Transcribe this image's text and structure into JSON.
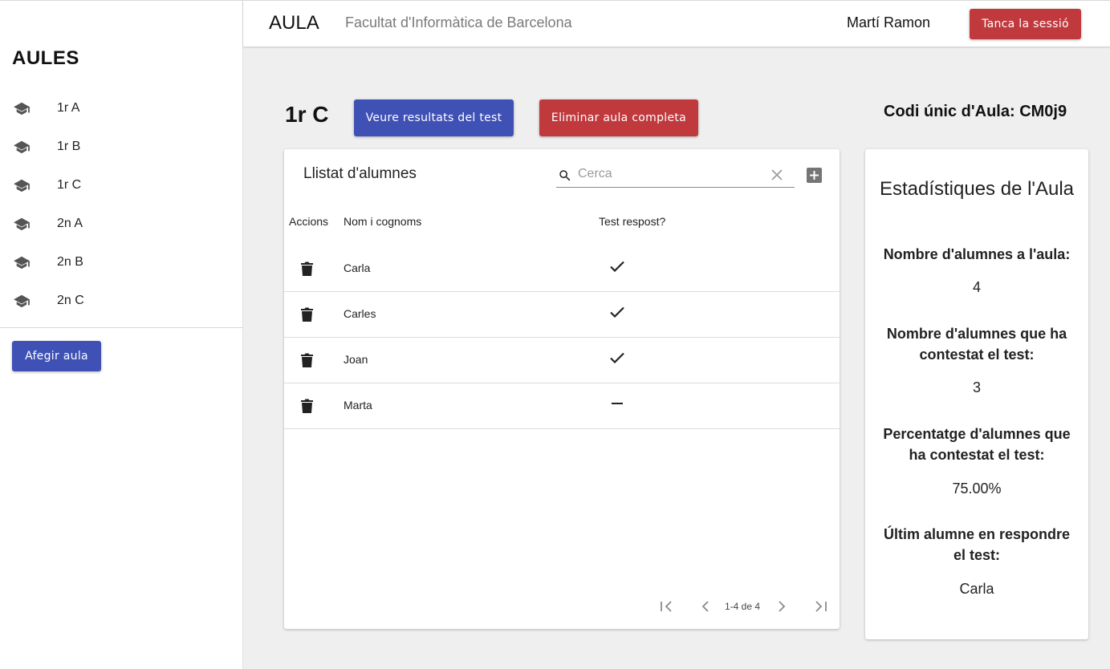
{
  "sidebar": {
    "title": "AULES",
    "items": [
      {
        "label": "1r A"
      },
      {
        "label": "1r B"
      },
      {
        "label": "1r C"
      },
      {
        "label": "2n A"
      },
      {
        "label": "2n B"
      },
      {
        "label": "2n C"
      }
    ],
    "add_label": "Afegir aula"
  },
  "header": {
    "app_title": "AULA",
    "subtitle": "Facultat d'Informàtica de Barcelona",
    "user_name": "Martí Ramon",
    "logout_label": "Tanca la sessió"
  },
  "aula": {
    "name": "1r C",
    "results_label": "Veure resultats del test",
    "delete_label": "Eliminar aula completa",
    "code_label": "Codi únic d'Aula: CM0j9"
  },
  "students": {
    "title": "Llistat d'alumnes",
    "search_placeholder": "Cerca",
    "columns": {
      "actions": "Accions",
      "name": "Nom i cognoms",
      "answered": "Test respost?"
    },
    "rows": [
      {
        "name": "Carla",
        "answered": true
      },
      {
        "name": "Carles",
        "answered": true
      },
      {
        "name": "Joan",
        "answered": true
      },
      {
        "name": "Marta",
        "answered": false
      }
    ],
    "pagination": "1-4 de 4"
  },
  "stats": {
    "title": "Estadístiques de l'Aula",
    "total_label": "Nombre d'alumnes a l'aula:",
    "total_value": "4",
    "answered_label": "Nombre d'alumnes que ha contestat el test:",
    "answered_value": "3",
    "percent_label": "Percentatge d'alumnes que ha contestat el test:",
    "percent_value": "75.00%",
    "last_label": "Últim alumne en respondre el test:",
    "last_value": "Carla"
  },
  "colors": {
    "primary": "#3f51b5",
    "danger": "#c0393d",
    "background": "#efefef"
  }
}
